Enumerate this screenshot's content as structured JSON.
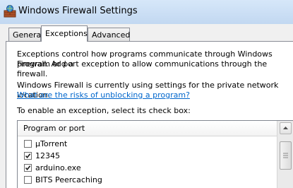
{
  "window": {
    "title": "Windows Firewall Settings",
    "icon": "firewall-icon"
  },
  "tabs": [
    {
      "label": "General",
      "active": false
    },
    {
      "label": "Exceptions",
      "active": true
    },
    {
      "label": "Advanced",
      "active": false
    }
  ],
  "exceptions": {
    "intro_line1": "Exceptions control how programs communicate through Windows Firewall. Add a",
    "intro_line2": "program or port exception to allow communications through the firewall.",
    "location_text": "Windows Firewall is currently using settings for the private network location.",
    "risks_link": "What are the risks of unblocking a program?",
    "instruction": "To enable an exception, select its check box:",
    "list": {
      "column_header": "Program or port",
      "items": [
        {
          "label": "µTorrent",
          "checked": false
        },
        {
          "label": "12345",
          "checked": true
        },
        {
          "label": "arduino.exe",
          "checked": true
        },
        {
          "label": "BITS Peercaching",
          "checked": false
        }
      ]
    }
  },
  "colors": {
    "title_bar": "#c9def5",
    "link": "#0066cc",
    "dialog_bg": "#f0f0f0"
  }
}
